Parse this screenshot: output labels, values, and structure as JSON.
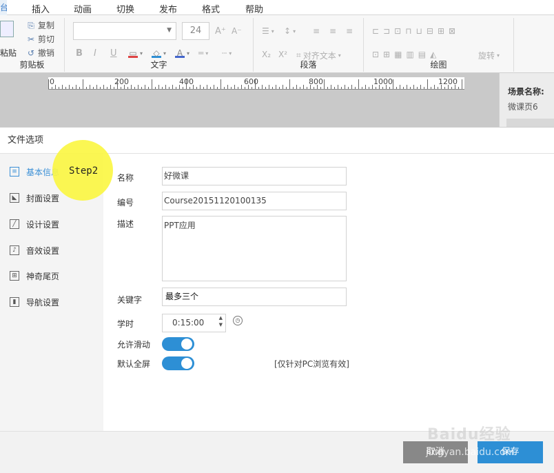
{
  "menubar": {
    "first_tab": "台",
    "items": [
      "插入",
      "动画",
      "切换",
      "发布",
      "格式",
      "帮助"
    ]
  },
  "ribbon": {
    "clipboard": {
      "paste": "粘贴",
      "copy": "复制",
      "cut": "剪切",
      "undo": "撤销",
      "label": "剪贴板"
    },
    "font": {
      "size_value": "24",
      "label": "文字",
      "bold": "B",
      "italic": "I",
      "underline": "U",
      "grow": "A⁺",
      "shrink": "A⁻"
    },
    "paragraph": {
      "label": "段落",
      "align_text": "对齐文本",
      "sub": "X₂",
      "sup": "X²"
    },
    "drawing": {
      "label": "绘图",
      "rotate": "旋转"
    }
  },
  "ruler": {
    "labels": [
      "0",
      "200",
      "400",
      "600",
      "800",
      "1000",
      "1200"
    ]
  },
  "scene_panel": {
    "title": "场景名称:",
    "value": "微课页6"
  },
  "dialog": {
    "title": "文件选项",
    "step_label": "Step2",
    "sidebar": [
      {
        "label": "基本信息",
        "icon": "list-icon"
      },
      {
        "label": "封面设置",
        "icon": "cover-icon"
      },
      {
        "label": "设计设置",
        "icon": "pencil-icon"
      },
      {
        "label": "音效设置",
        "icon": "music-icon"
      },
      {
        "label": "神奇尾页",
        "icon": "grid-icon"
      },
      {
        "label": "导航设置",
        "icon": "nav-icon"
      }
    ],
    "form": {
      "name_label": "名称",
      "name_value": "好微课",
      "id_label": "编号",
      "id_value": "Course20151120100135",
      "desc_label": "描述",
      "desc_value": "PPT应用",
      "keyword_label": "关键字",
      "keyword_value": "最多三个",
      "duration_label": "学时",
      "duration_value": "0:15:00",
      "allow_slide_label": "允许滑动",
      "fullscreen_label": "默认全屏",
      "fullscreen_note": "[仅针对PC浏览有效]"
    },
    "buttons": {
      "cancel": "取消",
      "save": "保存"
    }
  },
  "watermark": {
    "brand": "Baidu经验",
    "url": "jingyan.baidu.com"
  },
  "colors": {
    "accent": "#2d8fd5",
    "step_circle": "#fbf745",
    "cancel_button": "#888888"
  }
}
